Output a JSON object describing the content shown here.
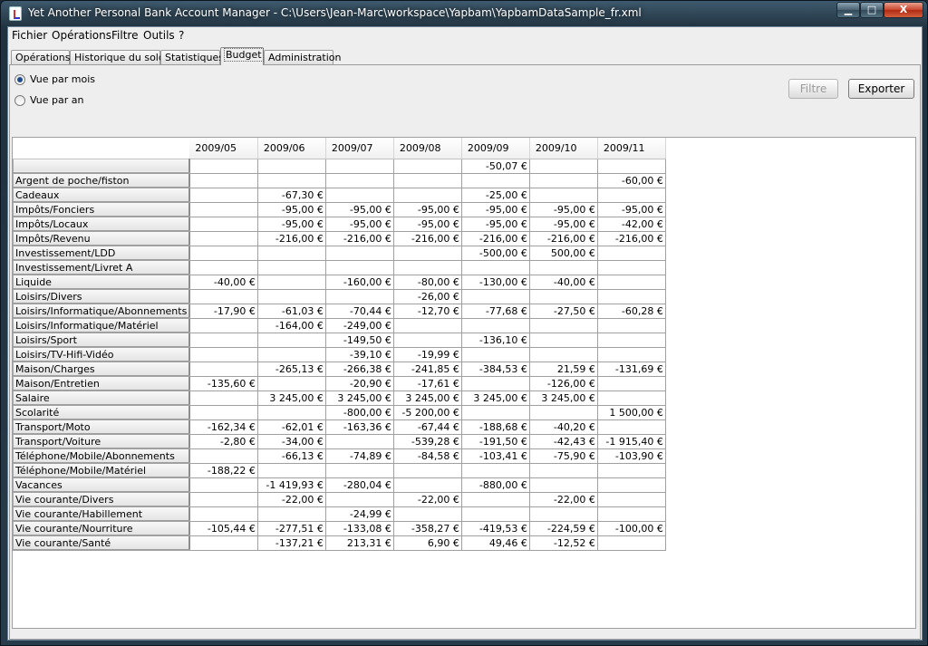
{
  "window": {
    "title": "Yet Another Personal Bank Account Manager - C:\\Users\\Jean-Marc\\workspace\\Yapbam\\YapbamDataSample_fr.xml",
    "minimize": "▁",
    "maximize": "□",
    "close": "X"
  },
  "menu": [
    "Fichier",
    "Opérations",
    "Filtre",
    "Outils",
    "?"
  ],
  "tabs": [
    "Opérations",
    "Historique du solde",
    "Statistiques",
    "Budget",
    "Administration"
  ],
  "active_tab": "Budget",
  "view": {
    "month_label": "Vue par mois",
    "year_label": "Vue par an",
    "selected": "month"
  },
  "buttons": {
    "filter": "Filtre",
    "export": "Exporter"
  },
  "table": {
    "columns": [
      "2009/05",
      "2009/06",
      "2009/07",
      "2009/08",
      "2009/09",
      "2009/10",
      "2009/11"
    ],
    "rows": [
      {
        "label": "",
        "values": [
          "",
          "",
          "",
          "",
          "-50,07 €",
          "",
          ""
        ]
      },
      {
        "label": "Argent de poche/fiston",
        "values": [
          "",
          "",
          "",
          "",
          "",
          "",
          "-60,00 €"
        ]
      },
      {
        "label": "Cadeaux",
        "values": [
          "",
          "-67,30 €",
          "",
          "",
          "-25,00 €",
          "",
          ""
        ]
      },
      {
        "label": "Impôts/Fonciers",
        "values": [
          "",
          "-95,00 €",
          "-95,00 €",
          "-95,00 €",
          "-95,00 €",
          "-95,00 €",
          "-95,00 €"
        ]
      },
      {
        "label": "Impôts/Locaux",
        "values": [
          "",
          "-95,00 €",
          "-95,00 €",
          "-95,00 €",
          "-95,00 €",
          "-95,00 €",
          "-42,00 €"
        ]
      },
      {
        "label": "Impôts/Revenu",
        "values": [
          "",
          "-216,00 €",
          "-216,00 €",
          "-216,00 €",
          "-216,00 €",
          "-216,00 €",
          "-216,00 €"
        ]
      },
      {
        "label": "Investissement/LDD",
        "values": [
          "",
          "",
          "",
          "",
          "-500,00 €",
          "500,00 €",
          ""
        ]
      },
      {
        "label": "Investissement/Livret A",
        "values": [
          "",
          "",
          "",
          "",
          "",
          "",
          ""
        ]
      },
      {
        "label": "Liquide",
        "values": [
          "-40,00 €",
          "",
          "-160,00 €",
          "-80,00 €",
          "-130,00 €",
          "-40,00 €",
          ""
        ]
      },
      {
        "label": "Loisirs/Divers",
        "values": [
          "",
          "",
          "",
          "-26,00 €",
          "",
          "",
          ""
        ]
      },
      {
        "label": "Loisirs/Informatique/Abonnements",
        "values": [
          "-17,90 €",
          "-61,03 €",
          "-70,44 €",
          "-12,70 €",
          "-77,68 €",
          "-27,50 €",
          "-60,28 €"
        ]
      },
      {
        "label": "Loisirs/Informatique/Matériel",
        "values": [
          "",
          "-164,00 €",
          "-249,00 €",
          "",
          "",
          "",
          ""
        ]
      },
      {
        "label": "Loisirs/Sport",
        "values": [
          "",
          "",
          "-149,50 €",
          "",
          "-136,10 €",
          "",
          ""
        ]
      },
      {
        "label": "Loisirs/TV-Hifi-Vidéo",
        "values": [
          "",
          "",
          "-39,10 €",
          "-19,99 €",
          "",
          "",
          ""
        ]
      },
      {
        "label": "Maison/Charges",
        "values": [
          "",
          "-265,13 €",
          "-266,38 €",
          "-241,85 €",
          "-384,53 €",
          "21,59 €",
          "-131,69 €"
        ]
      },
      {
        "label": "Maison/Entretien",
        "values": [
          "-135,60 €",
          "",
          "-20,90 €",
          "-17,61 €",
          "",
          "-126,00 €",
          ""
        ]
      },
      {
        "label": "Salaire",
        "values": [
          "",
          "3 245,00 €",
          "3 245,00 €",
          "3 245,00 €",
          "3 245,00 €",
          "3 245,00 €",
          ""
        ]
      },
      {
        "label": "Scolarité",
        "values": [
          "",
          "",
          "-800,00 €",
          "-5 200,00 €",
          "",
          "",
          "1 500,00 €"
        ]
      },
      {
        "label": "Transport/Moto",
        "values": [
          "-162,34 €",
          "-62,01 €",
          "-163,36 €",
          "-67,44 €",
          "-188,68 €",
          "-40,20 €",
          ""
        ]
      },
      {
        "label": "Transport/Voiture",
        "values": [
          "-2,80 €",
          "-34,00 €",
          "",
          "-539,28 €",
          "-191,50 €",
          "-42,43 €",
          "-1 915,40 €"
        ]
      },
      {
        "label": "Téléphone/Mobile/Abonnements",
        "values": [
          "",
          "-66,13 €",
          "-74,89 €",
          "-84,58 €",
          "-103,41 €",
          "-75,90 €",
          "-103,90 €"
        ]
      },
      {
        "label": "Téléphone/Mobile/Matériel",
        "values": [
          "-188,22 €",
          "",
          "",
          "",
          "",
          "",
          ""
        ]
      },
      {
        "label": "Vacances",
        "values": [
          "",
          "-1 419,93 €",
          "-280,04 €",
          "",
          "-880,00 €",
          "",
          ""
        ]
      },
      {
        "label": "Vie courante/Divers",
        "values": [
          "",
          "-22,00 €",
          "",
          "-22,00 €",
          "",
          "-22,00 €",
          ""
        ]
      },
      {
        "label": "Vie courante/Habillement",
        "values": [
          "",
          "",
          "-24,99 €",
          "",
          "",
          "",
          ""
        ]
      },
      {
        "label": "Vie courante/Nourriture",
        "values": [
          "-105,44 €",
          "-277,51 €",
          "-133,08 €",
          "-358,27 €",
          "-419,53 €",
          "-224,59 €",
          "-100,00 €"
        ]
      },
      {
        "label": "Vie courante/Santé",
        "values": [
          "",
          "-137,21 €",
          "213,31 €",
          "6,90 €",
          "49,46 €",
          "-12,52 €",
          ""
        ]
      }
    ]
  }
}
